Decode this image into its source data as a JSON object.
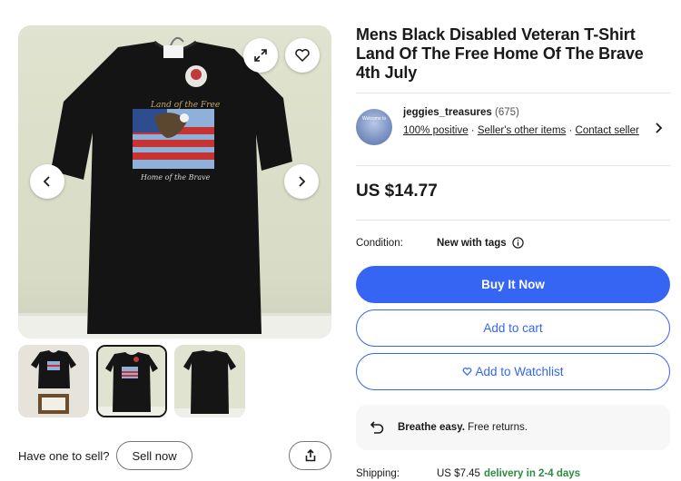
{
  "listing": {
    "title": "Mens Black Disabled Veteran T-Shirt Land Of The Free Home Of The Brave 4th July",
    "price": "US $14.77",
    "condition_label": "Condition:",
    "condition_value": "New with tags"
  },
  "seller": {
    "name": "jeggies_treasures",
    "feedback_count": "(675)",
    "avatar_text": "Welcome to",
    "positive": "100% positive",
    "sep1": " · ",
    "other_items": "Seller's other items",
    "sep2": " · ",
    "contact": "Contact seller"
  },
  "actions": {
    "buy_now": "Buy It Now",
    "add_to_cart": "Add to cart",
    "watchlist": "Add to Watchlist"
  },
  "returns": {
    "bold": "Breathe easy.",
    "text": " Free returns."
  },
  "shipping": {
    "label": "Shipping:",
    "cost": "US $7.45",
    "delivery": "delivery in 2-4 days"
  },
  "sell": {
    "question": "Have one to sell?",
    "button": "Sell now"
  },
  "shirt_print": {
    "top_text": "Land of the Free",
    "bottom_text": "Home of the Brave"
  },
  "colors": {
    "accent_blue": "#3665f3",
    "delivery_green": "#2a8c3e"
  },
  "icons": [
    "expand-icon",
    "heart-icon",
    "chevron-left-icon",
    "chevron-right-icon",
    "info-icon",
    "return-icon",
    "share-icon",
    "chevron-right-icon"
  ]
}
